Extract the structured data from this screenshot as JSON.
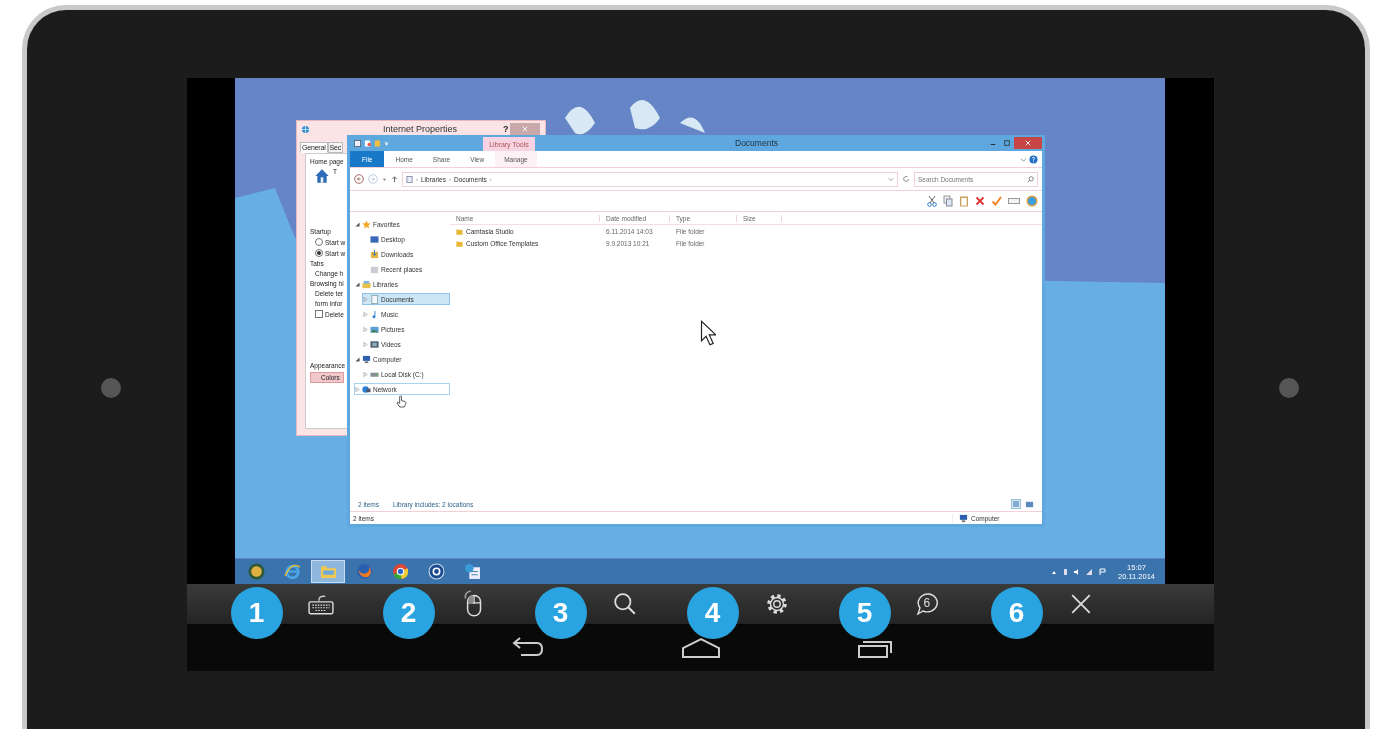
{
  "internet_properties": {
    "title": "Internet Properties",
    "help": "?",
    "tabs": [
      {
        "label": "General",
        "selected": true
      },
      {
        "label": "Sec",
        "selected": false
      }
    ],
    "lines": [
      {
        "kind": "heading",
        "text": "Home page"
      },
      {
        "kind": "house",
        "text": "T"
      },
      {
        "kind": "spacer"
      },
      {
        "kind": "heading",
        "text": "Startup"
      },
      {
        "kind": "radio",
        "text": "Start w",
        "checked": false
      },
      {
        "kind": "radio",
        "text": "Start w",
        "checked": true
      },
      {
        "kind": "heading",
        "text": "Tabs"
      },
      {
        "kind": "text",
        "text": "Change h"
      },
      {
        "kind": "heading",
        "text": "Browsing hi"
      },
      {
        "kind": "text",
        "text": "Delete ter"
      },
      {
        "kind": "text",
        "text": "form infor"
      },
      {
        "kind": "checkbox",
        "text": "Delete",
        "checked": false
      },
      {
        "kind": "spacer"
      },
      {
        "kind": "heading",
        "text": "Appearance"
      },
      {
        "kind": "button",
        "text": "Colors"
      }
    ]
  },
  "documents_window": {
    "title": "Documents",
    "context_tab": "Library Tools",
    "ribbon_tabs": [
      {
        "label": "File",
        "kind": "file"
      },
      {
        "label": "Home",
        "kind": "tab"
      },
      {
        "label": "Share",
        "kind": "tab"
      },
      {
        "label": "View",
        "kind": "tab"
      },
      {
        "label": "Manage",
        "kind": "tab"
      }
    ],
    "path": [
      "Libraries",
      "Documents"
    ],
    "path_separator": "›",
    "search": {
      "placeholder": "Search Documents"
    },
    "nav_tree": [
      {
        "label": "Favorites",
        "kind": "star",
        "expanded": true,
        "selected": false,
        "hovered": false,
        "children": [
          {
            "label": "Desktop",
            "kind": "desktop",
            "selected": false,
            "hovered": false
          },
          {
            "label": "Downloads",
            "kind": "download",
            "selected": false,
            "hovered": false
          },
          {
            "label": "Recent places",
            "kind": "recent",
            "selected": false,
            "hovered": false
          }
        ]
      },
      {
        "label": "Libraries",
        "kind": "library",
        "expanded": true,
        "selected": false,
        "hovered": false,
        "children": [
          {
            "label": "Documents",
            "kind": "document",
            "expanded": false,
            "selected": true,
            "hovered": false
          },
          {
            "label": "Music",
            "kind": "music",
            "expanded": false,
            "selected": false,
            "hovered": false
          },
          {
            "label": "Pictures",
            "kind": "picture",
            "expanded": false,
            "selected": false,
            "hovered": false
          },
          {
            "label": "Videos",
            "kind": "video",
            "expanded": false,
            "selected": false,
            "hovered": false
          }
        ]
      },
      {
        "label": "Computer",
        "kind": "computer",
        "expanded": true,
        "selected": false,
        "hovered": false,
        "children": [
          {
            "label": "Local Disk (C:)",
            "kind": "disk",
            "expanded": false,
            "selected": false,
            "hovered": false
          }
        ]
      },
      {
        "label": "Network",
        "kind": "network",
        "expanded": false,
        "selected": false,
        "hovered": true
      }
    ],
    "columns": [
      "Name",
      "Date modified",
      "Type",
      "Size"
    ],
    "rows": [
      {
        "name": "Camtasia Studio",
        "date": "6.11.2014 14:03",
        "type": "File folder"
      },
      {
        "name": "Custom Office Templates",
        "date": "9.9.2013 10:21",
        "type": "File folder"
      }
    ],
    "item_count": "2 items",
    "library_info": "Library includes: 2 locations",
    "status_bar": {
      "items": "2 items",
      "location": "Computer"
    }
  },
  "taskbar": {
    "apps": [
      {
        "kind": "start",
        "active": false
      },
      {
        "kind": "ie",
        "active": false
      },
      {
        "kind": "explorer",
        "active": true
      },
      {
        "kind": "firefox",
        "active": false
      },
      {
        "kind": "chrome",
        "active": false
      },
      {
        "kind": "app",
        "active": false
      },
      {
        "kind": "control",
        "active": false
      }
    ],
    "time": "15:07",
    "date": "20.11.2014"
  },
  "toolbar": [
    {
      "kind": "keyboard",
      "callout": "1"
    },
    {
      "kind": "mouse",
      "callout": "2"
    },
    {
      "kind": "search",
      "callout": "3"
    },
    {
      "kind": "settings",
      "callout": "4"
    },
    {
      "kind": "chat",
      "callout": "5",
      "badge": "6"
    },
    {
      "kind": "close",
      "callout": "6"
    }
  ]
}
